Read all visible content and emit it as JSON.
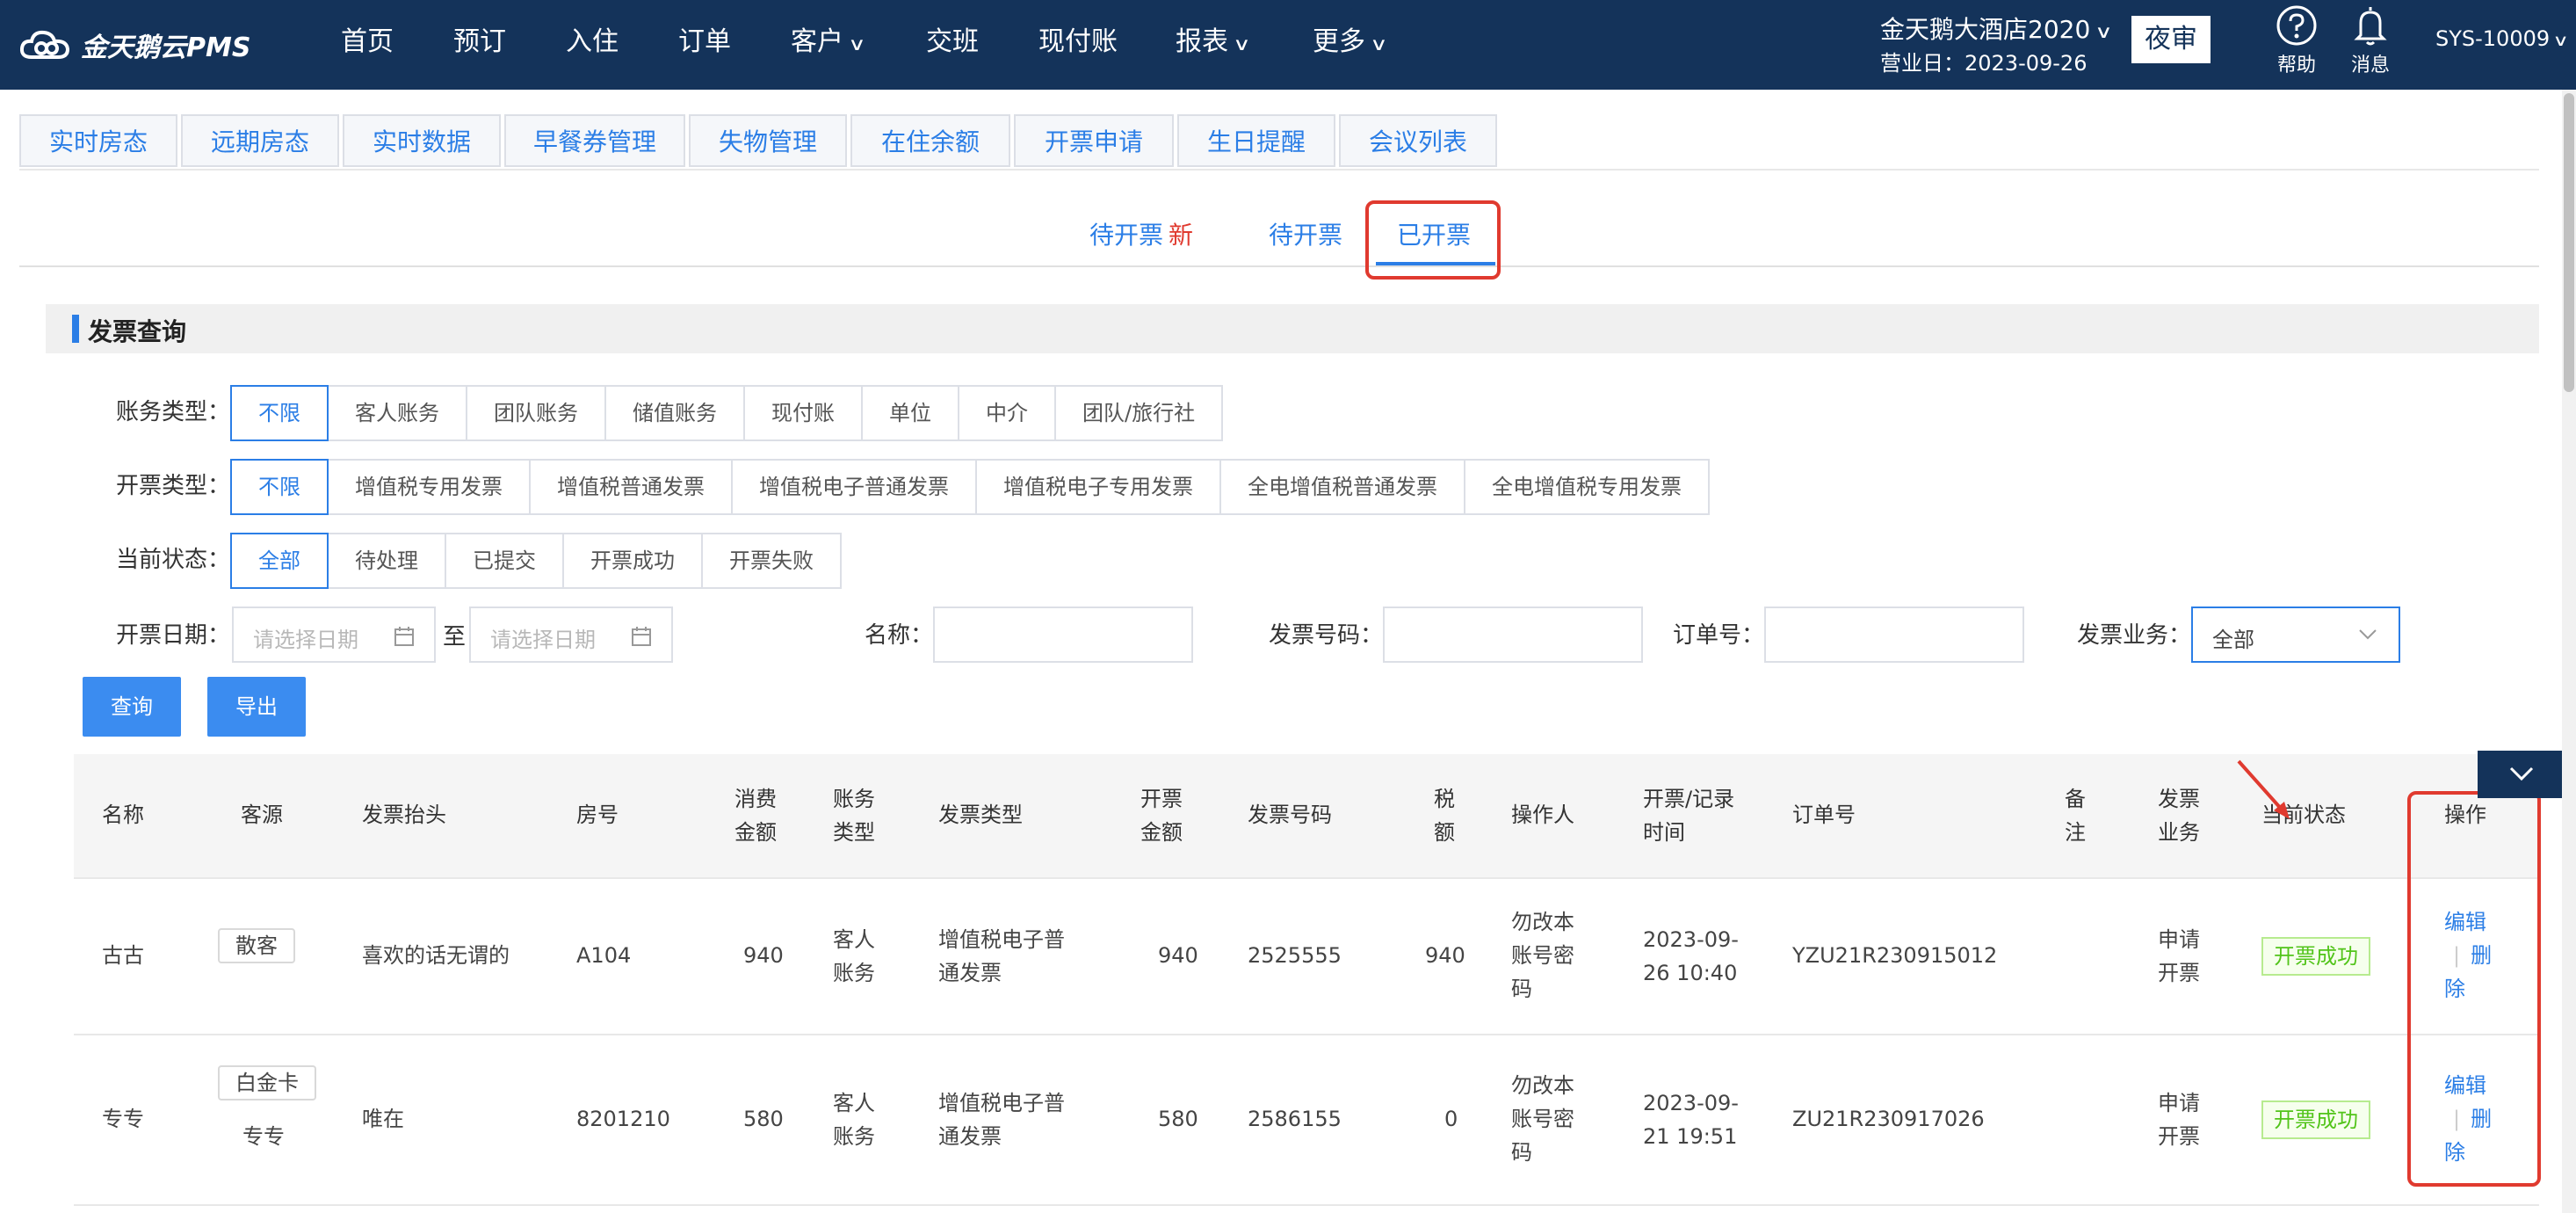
{
  "app": {
    "logo": "金天鹅云PMS"
  },
  "nav": [
    {
      "label": "首页",
      "dropdown": false
    },
    {
      "label": "预订",
      "dropdown": false
    },
    {
      "label": "入住",
      "dropdown": false
    },
    {
      "label": "订单",
      "dropdown": false
    },
    {
      "label": "客户",
      "dropdown": true
    },
    {
      "label": "交班",
      "dropdown": false
    },
    {
      "label": "现付账",
      "dropdown": false
    },
    {
      "label": "报表",
      "dropdown": true
    },
    {
      "label": "更多",
      "dropdown": true
    }
  ],
  "header_right": {
    "hotel": "金天鹅大酒店2020",
    "business_date": "营业日：2023-09-26",
    "night_audit": "夜审",
    "help": "帮助",
    "messages": "消息",
    "user": "SYS-10009"
  },
  "function_tabs": [
    "实时房态",
    "远期房态",
    "实时数据",
    "早餐券管理",
    "失物管理",
    "在住余额",
    "开票申请",
    "生日提醒",
    "会议列表"
  ],
  "sub_tabs": [
    {
      "label": "待开票",
      "badge": "新"
    },
    {
      "label": "待开票",
      "badge": ""
    },
    {
      "label": "已开票",
      "badge": ""
    }
  ],
  "section_title": "发票查询",
  "filters": {
    "account_type": {
      "label": "账务类型：",
      "options": [
        "不限",
        "客人账务",
        "团队账务",
        "储值账务",
        "现付账",
        "单位",
        "中介",
        "团队/旅行社"
      ],
      "selected": 0
    },
    "invoice_type": {
      "label": "开票类型：",
      "options": [
        "不限",
        "增值税专用发票",
        "增值税普通发票",
        "增值税电子普通发票",
        "增值税电子专用发票",
        "全电增值税普通发票",
        "全电增值税专用发票"
      ],
      "selected": 0
    },
    "status": {
      "label": "当前状态：",
      "options": [
        "全部",
        "待处理",
        "已提交",
        "开票成功",
        "开票失败"
      ],
      "selected": 0
    },
    "date": {
      "label": "开票日期：",
      "start_placeholder": "请选择日期",
      "to": "至",
      "end_placeholder": "请选择日期"
    },
    "name": {
      "label": "名称：",
      "value": ""
    },
    "invoice_no": {
      "label": "发票号码：",
      "value": ""
    },
    "order_no": {
      "label": "订单号：",
      "value": ""
    },
    "business": {
      "label": "发票业务：",
      "value": "全部"
    }
  },
  "buttons": {
    "query": "查询",
    "export": "导出"
  },
  "table": {
    "headers": {
      "name": "名称",
      "source": "客源",
      "title": "发票抬头",
      "room": "房号",
      "amount_1": "消费",
      "amount_2": "金额",
      "acct_1": "账务",
      "acct_2": "类型",
      "type": "发票类型",
      "inv_amt_1": "开票",
      "inv_amt_2": "金额",
      "inv_no": "发票号码",
      "tax_1": "税",
      "tax_2": "额",
      "operator": "操作人",
      "time_1": "开票/记录",
      "time_2": "时间",
      "order": "订单号",
      "remark_1": "备",
      "remark_2": "注",
      "biz_1": "发票",
      "biz_2": "业务",
      "status": "当前状态",
      "action": "操作"
    },
    "rows": [
      {
        "name": "古古",
        "source": "散客",
        "source_sub": "",
        "title": "喜欢的话无谓的",
        "room": "A104",
        "amount": "940",
        "acct_1": "客人",
        "acct_2": "账务",
        "type_1": "增值税电子普",
        "type_2": "通发票",
        "inv_amount": "940",
        "inv_no": "2525555",
        "tax": "940",
        "op_1": "勿改本",
        "op_2": "账号密",
        "op_3": "码",
        "time_1": "2023-09-",
        "time_2": "26 10:40",
        "order": "YZU21R230915012",
        "remark": "",
        "biz_1": "申请",
        "biz_2": "开票",
        "status": "开票成功",
        "edit": "编辑",
        "del_1": "删",
        "del_2": "除"
      },
      {
        "name": "专专",
        "source": "白金卡",
        "source_sub": "专专",
        "title": "唯在",
        "room": "8201210",
        "amount": "580",
        "acct_1": "客人",
        "acct_2": "账务",
        "type_1": "增值税电子普",
        "type_2": "通发票",
        "inv_amount": "580",
        "inv_no": "2586155",
        "tax": "0",
        "op_1": "勿改本",
        "op_2": "账号密",
        "op_3": "码",
        "time_1": "2023-09-",
        "time_2": "21 19:51",
        "order": "ZU21R230917026",
        "remark": "",
        "biz_1": "申请",
        "biz_2": "开票",
        "status": "开票成功",
        "edit": "编辑",
        "del_1": "删",
        "del_2": "除"
      }
    ]
  },
  "colors": {
    "nav_bg": "#14335a",
    "accent": "#2b7ee6",
    "success": "#52c41a",
    "highlight": "#e03a2f"
  }
}
